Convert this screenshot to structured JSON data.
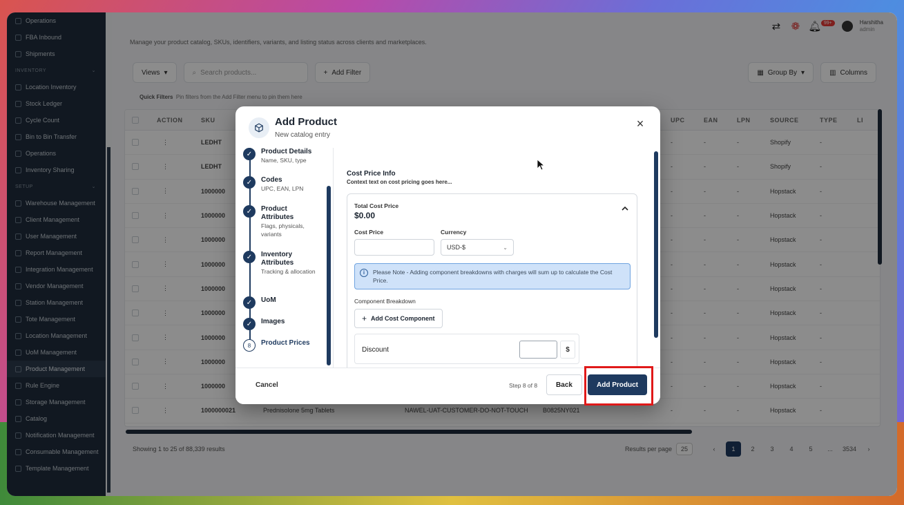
{
  "sidebar": {
    "items_top": [
      {
        "label": "Operations"
      },
      {
        "label": "FBA Inbound"
      },
      {
        "label": "Shipments"
      }
    ],
    "section_inventory": "INVENTORY",
    "items_inventory": [
      {
        "label": "Location Inventory"
      },
      {
        "label": "Stock Ledger"
      },
      {
        "label": "Cycle Count"
      },
      {
        "label": "Bin to Bin Transfer"
      },
      {
        "label": "Operations"
      },
      {
        "label": "Inventory Sharing"
      }
    ],
    "section_setup": "SETUP",
    "items_setup": [
      {
        "label": "Warehouse Management"
      },
      {
        "label": "Client Management"
      },
      {
        "label": "User Management"
      },
      {
        "label": "Report Management"
      },
      {
        "label": "Integration Management"
      },
      {
        "label": "Vendor Management"
      },
      {
        "label": "Station Management"
      },
      {
        "label": "Tote Management"
      },
      {
        "label": "Location Management"
      },
      {
        "label": "UoM Management"
      },
      {
        "label": "Product Management"
      },
      {
        "label": "Rule Engine"
      },
      {
        "label": "Storage Management"
      },
      {
        "label": "Catalog"
      },
      {
        "label": "Notification Management"
      },
      {
        "label": "Consumable Management"
      },
      {
        "label": "Template Management"
      }
    ]
  },
  "header": {
    "notification_count": "99+",
    "user_name": "Harshitha",
    "user_sub": "admin",
    "subtitle": "Manage your product catalog, SKUs, identifiers, variants, and listing status across clients and marketplaces."
  },
  "toolbar": {
    "views": "Views",
    "search_placeholder": "Search products...",
    "add_filter": "Add Filter",
    "group_by": "Group By",
    "columns": "Columns"
  },
  "quick_filters": {
    "label": "Quick Filters",
    "hint": "Pin filters from the Add Filter menu to pin them here"
  },
  "table": {
    "headers": {
      "action": "ACTION",
      "sku": "SKU",
      "upc": "UPC",
      "ean": "EAN",
      "lpn": "LPN",
      "source": "SOURCE",
      "type": "TYPE",
      "li": "LI"
    },
    "rows": [
      {
        "sku": "LEDHT",
        "name": "",
        "client": "",
        "asin": "",
        "upc": "-",
        "ean": "-",
        "lpn": "-",
        "source": "Shopify",
        "type": "-"
      },
      {
        "sku": "LEDHT",
        "name": "",
        "client": "",
        "asin": "",
        "upc": "-",
        "ean": "-",
        "lpn": "-",
        "source": "Shopify",
        "type": "-"
      },
      {
        "sku": "1000000",
        "name": "",
        "client": "",
        "asin": "",
        "upc": "-",
        "ean": "-",
        "lpn": "-",
        "source": "Hopstack",
        "type": "-"
      },
      {
        "sku": "1000000",
        "name": "",
        "client": "",
        "asin": "",
        "upc": "-",
        "ean": "-",
        "lpn": "-",
        "source": "Hopstack",
        "type": "-"
      },
      {
        "sku": "1000000",
        "name": "",
        "client": "",
        "asin": "",
        "upc": "-",
        "ean": "-",
        "lpn": "-",
        "source": "Hopstack",
        "type": "-"
      },
      {
        "sku": "1000000",
        "name": "",
        "client": "",
        "asin": "",
        "upc": "-",
        "ean": "-",
        "lpn": "-",
        "source": "Hopstack",
        "type": "-"
      },
      {
        "sku": "1000000",
        "name": "",
        "client": "",
        "asin": "",
        "upc": "-",
        "ean": "-",
        "lpn": "-",
        "source": "Hopstack",
        "type": "-"
      },
      {
        "sku": "1000000",
        "name": "",
        "client": "",
        "asin": "",
        "upc": "-",
        "ean": "-",
        "lpn": "-",
        "source": "Hopstack",
        "type": "-"
      },
      {
        "sku": "1000000",
        "name": "",
        "client": "",
        "asin": "",
        "upc": "-",
        "ean": "-",
        "lpn": "-",
        "source": "Hopstack",
        "type": "-"
      },
      {
        "sku": "1000000",
        "name": "",
        "client": "",
        "asin": "",
        "upc": "-",
        "ean": "-",
        "lpn": "-",
        "source": "Hopstack",
        "type": "-"
      },
      {
        "sku": "1000000",
        "name": "",
        "client": "",
        "asin": "",
        "upc": "-",
        "ean": "-",
        "lpn": "-",
        "source": "Hopstack",
        "type": "-"
      },
      {
        "sku": "1000000021",
        "name": "Prednisolone 5mg Tablets",
        "client": "NAWEL-UAT-CUSTOMER-DO-NOT-TOUCH",
        "asin": "B0825NY021",
        "upc": "-",
        "ean": "-",
        "lpn": "-",
        "source": "Hopstack",
        "type": "-"
      }
    ]
  },
  "footer": {
    "showing": "Showing 1 to 25 of 88,339 results",
    "results_per_page_label": "Results per page",
    "results_per_page": "25",
    "pages": [
      "1",
      "2",
      "3",
      "4",
      "5",
      "...",
      "3534"
    ]
  },
  "modal": {
    "title": "Add Product",
    "subtitle": "New catalog entry",
    "steps": [
      {
        "label": "Product Details",
        "desc": "Name, SKU, type",
        "state": "done"
      },
      {
        "label": "Codes",
        "desc": "UPC, EAN, LPN",
        "state": "done"
      },
      {
        "label": "Product Attributes",
        "desc": "Flags, physicals, variants",
        "state": "done"
      },
      {
        "label": "Inventory Attributes",
        "desc": "Tracking & allocation",
        "state": "done"
      },
      {
        "label": "UoM",
        "desc": "",
        "state": "done"
      },
      {
        "label": "Images",
        "desc": "",
        "state": "done"
      },
      {
        "label": "Product Prices",
        "desc": "",
        "state": "current",
        "number": "8"
      }
    ],
    "section_title": "Cost Price Info",
    "section_sub": "Context text on cost pricing goes here...",
    "total_cost_label": "Total Cost Price",
    "total_cost_value": "$0.00",
    "cost_price_label": "Cost Price",
    "cost_price_value": "",
    "currency_label": "Currency",
    "currency_value": "USD-$",
    "note": "Please Note - Adding component breakdowns with charges will sum up to calculate the Cost Price.",
    "component_breakdown_label": "Component Breakdown",
    "add_component": "Add Cost Component",
    "discount_label": "Discount",
    "discount_value": "",
    "discount_unit": "$",
    "cancel": "Cancel",
    "step_info": "Step 8 of 8",
    "back": "Back",
    "submit": "Add Product"
  }
}
